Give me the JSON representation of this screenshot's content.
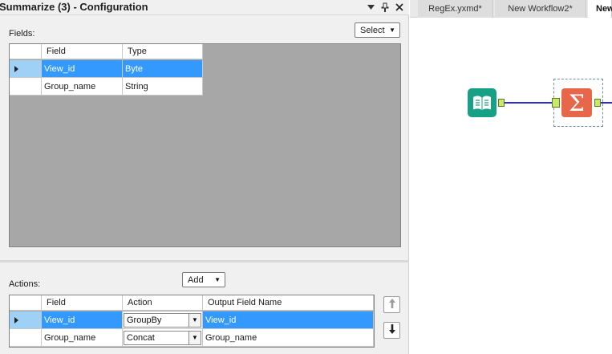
{
  "panel": {
    "title": "Summarize (3)  - Configuration",
    "pin_icon": "pin-icon",
    "close_icon": "close-icon"
  },
  "fields_section": {
    "label": "Fields:",
    "select_button": "Select",
    "columns": [
      "Field",
      "Type"
    ],
    "rows": [
      {
        "field": "View_id",
        "type": "Byte",
        "selected": true
      },
      {
        "field": "Group_name",
        "type": "String",
        "selected": false
      }
    ]
  },
  "actions_section": {
    "label": "Actions:",
    "add_button": "Add",
    "columns": [
      "Field",
      "Action",
      "Output Field Name"
    ],
    "rows": [
      {
        "field": "View_id",
        "action": "GroupBy",
        "output": "View_id",
        "selected": true
      },
      {
        "field": "Group_name",
        "action": "Concat",
        "output": "Group_name",
        "selected": false
      }
    ],
    "move_up_icon": "arrow-up-icon",
    "move_down_icon": "arrow-down-icon"
  },
  "canvas": {
    "tabs": [
      "RegEx.yxmd*",
      "New Workflow2*",
      "New"
    ],
    "active_tab": "New",
    "tools": [
      "input-data-tool",
      "summarize-tool"
    ],
    "colors": {
      "connection": "#2f2fd0",
      "input_tool": "#16a085",
      "summarize_tool": "#e8664a",
      "selection": "#3399ff"
    }
  }
}
